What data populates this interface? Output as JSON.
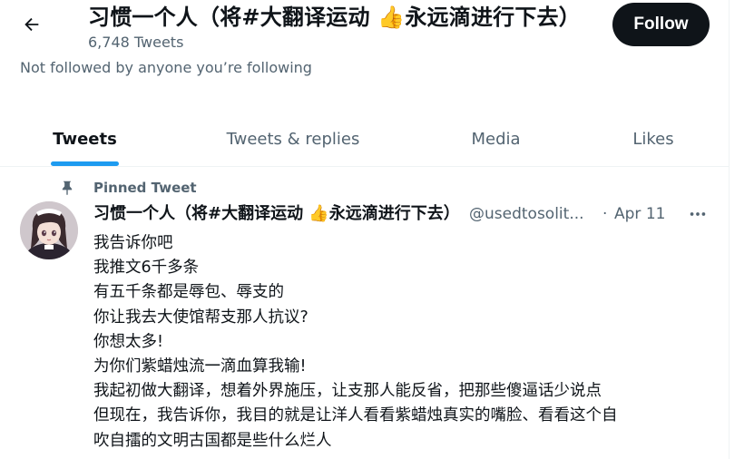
{
  "header": {
    "back_icon": "arrow-left-icon",
    "profile_name": "习惯一个人（将#大翻译运动 👍永远滴进行下去）",
    "tweet_count": "6,748 Tweets",
    "follow_label": "Follow",
    "followers_note": "Not followed by anyone you’re following"
  },
  "tabs": [
    {
      "label": "Tweets",
      "active": true
    },
    {
      "label": "Tweets & replies",
      "active": false
    },
    {
      "label": "Media",
      "active": false
    },
    {
      "label": "Likes",
      "active": false
    }
  ],
  "pinned_tweet": {
    "pin_icon": "pin-icon",
    "pinned_label": "Pinned Tweet",
    "author_name": "习惯一个人（将#大翻译运动 👍永远滴进行下去）",
    "author_handle": "@usedtosolit...",
    "separator": "·",
    "date": "Apr 11",
    "more_icon": "more-horizontal-icon",
    "lines": [
      "我告诉你吧",
      "我推文6千多条",
      "有五千条都是辱包、辱支的",
      "你让我去大使馆帮支那人抗议?",
      "你想太多!",
      "为你们紫蜡烛流一滴血算我输!",
      "我起初做大翻译，想着外界施压，让支那人能反省，把那些傻逼话少说点",
      "但现在，我告诉你，我目的就是让洋人看看紫蜡烛真实的嘴脸、看看这个自",
      "吹自擂的文明古国都是些什么烂人"
    ]
  },
  "colors": {
    "text_primary": "#0f1419",
    "text_secondary": "#536471",
    "accent": "#1d9bf0",
    "follow_bg": "#0f1419"
  }
}
